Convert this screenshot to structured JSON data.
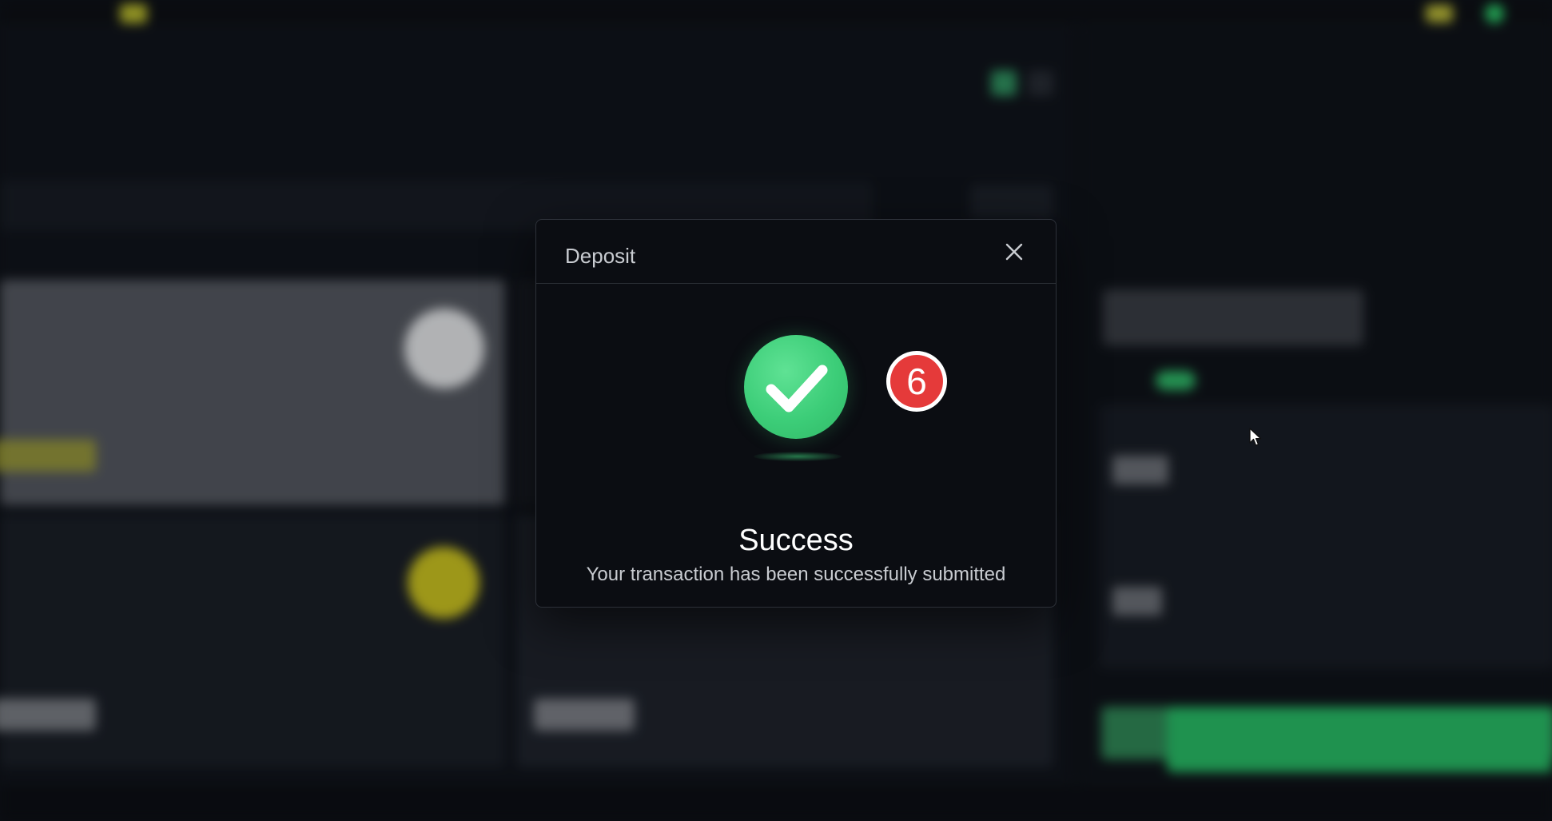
{
  "modal": {
    "title": "Deposit",
    "step_number": "6",
    "success_title": "Success",
    "success_message": "Your transaction has been successfully submitted"
  },
  "icons": {
    "close": "close-icon",
    "success": "checkmark-icon",
    "cursor": "mouse-pointer-icon"
  },
  "colors": {
    "success_green": "#3ccd78",
    "badge_red": "#e53a3a",
    "accent_yellow": "#c8c636"
  }
}
